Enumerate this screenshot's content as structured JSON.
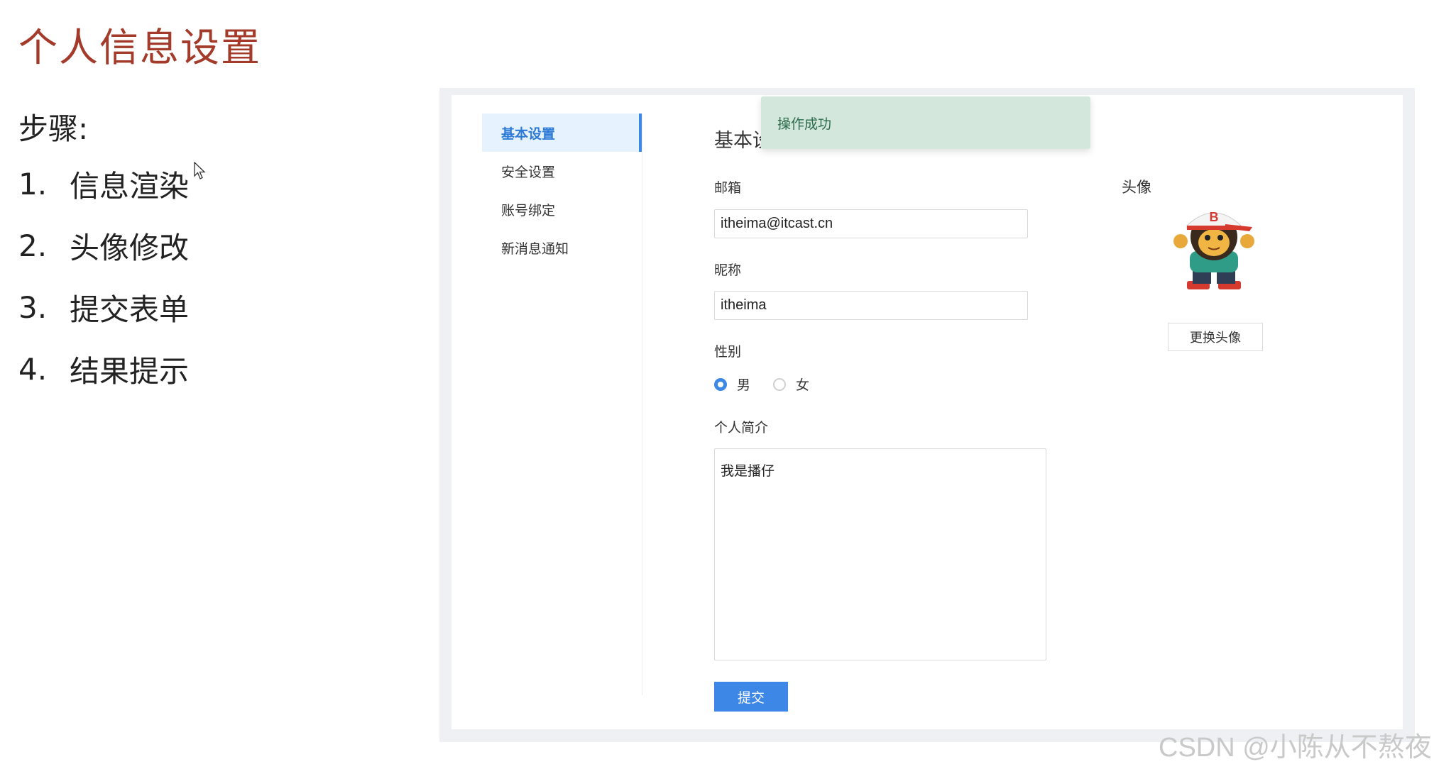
{
  "slide": {
    "title": "个人信息设置",
    "steps_heading": "步骤:",
    "steps": [
      {
        "num": "1.",
        "text": "信息渲染"
      },
      {
        "num": "2.",
        "text": "头像修改"
      },
      {
        "num": "3.",
        "text": "提交表单"
      },
      {
        "num": "4.",
        "text": "结果提示"
      }
    ]
  },
  "app": {
    "menu": [
      {
        "label": "基本设置",
        "active": true
      },
      {
        "label": "安全设置",
        "active": false
      },
      {
        "label": "账号绑定",
        "active": false
      },
      {
        "label": "新消息通知",
        "active": false
      }
    ],
    "section_title": "基本设置",
    "toast": "操作成功",
    "form": {
      "email_label": "邮箱",
      "email_value": "itheima@itcast.cn",
      "nickname_label": "昵称",
      "nickname_value": "itheima",
      "gender_label": "性别",
      "gender_options": [
        "男",
        "女"
      ],
      "gender_selected": "男",
      "intro_label": "个人简介",
      "intro_value": "我是播仔",
      "submit_label": "提交"
    },
    "avatar": {
      "label": "头像",
      "change_button": "更换头像",
      "cap_letter": "B"
    }
  },
  "watermark": "CSDN @小陈从不熬夜",
  "colors": {
    "title": "#a33a2a",
    "primary": "#3d88e6",
    "toast_bg": "#d3e7dc",
    "active_menu_bg": "#e7f2ff"
  }
}
